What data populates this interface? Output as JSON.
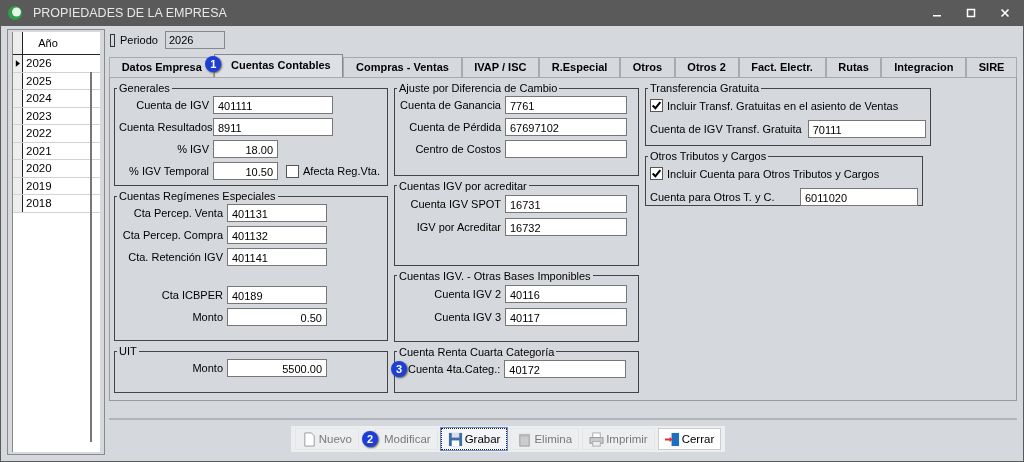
{
  "window": {
    "title": "PROPIEDADES DE LA EMPRESA"
  },
  "years": {
    "header": "Año",
    "rows": [
      {
        "label": "2026",
        "selected": true
      },
      {
        "label": "2025",
        "selected": false
      },
      {
        "label": "2024",
        "selected": false
      },
      {
        "label": "2023",
        "selected": false
      },
      {
        "label": "2022",
        "selected": false
      },
      {
        "label": "2021",
        "selected": false
      },
      {
        "label": "2020",
        "selected": false
      },
      {
        "label": "2019",
        "selected": false
      },
      {
        "label": "2018",
        "selected": false
      }
    ]
  },
  "period": {
    "label": "Periodo",
    "value": "2026"
  },
  "tabs": [
    {
      "label": "Datos Empresa",
      "selected": false
    },
    {
      "label": "Cuentas Contables",
      "selected": true,
      "badge": "1"
    },
    {
      "label": "Compras - Ventas",
      "selected": false
    },
    {
      "label": "IVAP / ISC",
      "selected": false
    },
    {
      "label": "R.Especial",
      "selected": false
    },
    {
      "label": "Otros",
      "selected": false
    },
    {
      "label": "Otros 2",
      "selected": false
    },
    {
      "label": "Fact. Electr.",
      "selected": false
    },
    {
      "label": "Rutas",
      "selected": false
    },
    {
      "label": "Integracion",
      "selected": false
    },
    {
      "label": "SIRE",
      "selected": false
    }
  ],
  "columns": [
    [
      {
        "title": "Generales",
        "rows": [
          {
            "kind": "field",
            "label": "Cuenta de IGV",
            "value": "401111"
          },
          {
            "kind": "field",
            "label": "Cuenta Resultados",
            "value": "8911"
          },
          {
            "kind": "amount",
            "label": "% IGV",
            "value": "18.00"
          },
          {
            "kind": "amount",
            "label": "% IGV Temporal",
            "value": "10.50",
            "checkbox": {
              "label": "Afecta Reg.Vta.",
              "checked": false
            }
          }
        ]
      },
      {
        "title": "Cuentas Regímenes Especiales",
        "rows": [
          {
            "kind": "field",
            "label": "Cta Percep. Venta",
            "value": "401131"
          },
          {
            "kind": "field",
            "label": "Cta Percep. Compra",
            "value": "401132"
          },
          {
            "kind": "field",
            "label": "Cta. Retención IGV",
            "value": "401141"
          },
          {
            "kind": "field",
            "label": "Cta ICBPER",
            "value": "40189"
          },
          {
            "kind": "amount",
            "label": "Monto",
            "value": "0.50"
          }
        ]
      },
      {
        "title": "UIT",
        "rows": [
          {
            "kind": "amount",
            "label": "Monto",
            "value": "5500.00"
          }
        ]
      }
    ],
    [
      {
        "title": "Ajuste por Diferencia de Cambio",
        "rows": [
          {
            "kind": "field",
            "label": "Cuenta de Ganancia",
            "value": "7761"
          },
          {
            "kind": "field",
            "label": "Cuenta de Pérdida",
            "value": "67697102"
          },
          {
            "kind": "field",
            "label": "Centro de Costos",
            "value": ""
          }
        ]
      },
      {
        "title": "Cuentas IGV por acreditar",
        "rows": [
          {
            "kind": "field",
            "label": "Cuenta IGV SPOT",
            "value": "16731"
          },
          {
            "kind": "field",
            "label": "IGV por Acreditar",
            "value": "16732"
          }
        ]
      },
      {
        "title": "Cuentas IGV. - Otras Bases Imponibles",
        "rows": [
          {
            "kind": "field",
            "label": "Cuenta IGV 2",
            "value": "40116"
          },
          {
            "kind": "field",
            "label": "Cuenta IGV 3",
            "value": "40117"
          }
        ]
      },
      {
        "title": "Cuenta Renta Cuarta Categoría",
        "rows": [
          {
            "kind": "field",
            "label": "Cuenta 4ta.Categ.:",
            "value": "40172",
            "badge": "3"
          }
        ]
      }
    ],
    [
      {
        "title": "Transferencia Gratuita",
        "rows": [
          {
            "kind": "checkbox",
            "label": "Incluir Transf. Gratuitas en el asiento de Ventas",
            "checked": true
          },
          {
            "kind": "field",
            "label": "Cuenta de IGV Transf. Gratuita",
            "value": "70111"
          }
        ]
      },
      {
        "title": "Otros Tributos y Cargos",
        "rows": [
          {
            "kind": "checkbox",
            "label": "Incluir Cuenta para Otros Tributos y Cargos",
            "checked": true
          },
          {
            "kind": "field",
            "label": "Cuenta para Otros T. y C.",
            "value": "6011020"
          }
        ]
      }
    ]
  ],
  "buttons": [
    {
      "label": "Nuevo",
      "disabled": true,
      "focused": false
    },
    {
      "label": "Modificar",
      "disabled": true,
      "focused": false,
      "badge": "2"
    },
    {
      "label": "Grabar",
      "disabled": false,
      "focused": true
    },
    {
      "label": "Elimina",
      "disabled": true,
      "focused": false
    },
    {
      "label": "Imprimir",
      "disabled": true,
      "focused": false
    },
    {
      "label": "Cerrar",
      "disabled": false,
      "focused": false
    }
  ]
}
